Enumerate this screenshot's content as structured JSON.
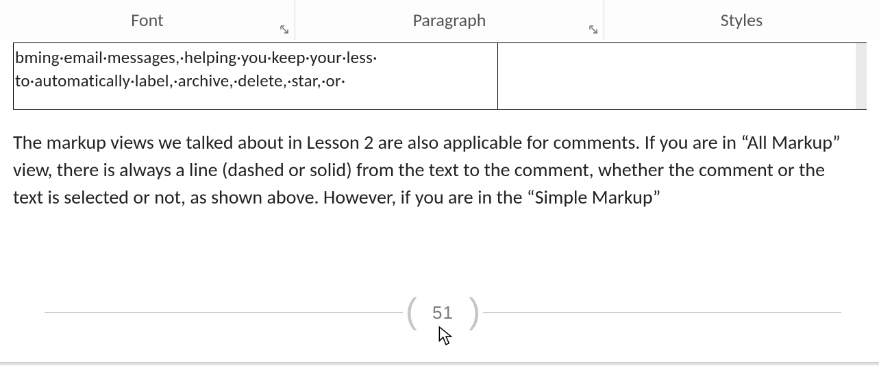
{
  "ribbon": {
    "groups": {
      "font": {
        "label": "Font"
      },
      "paragraph": {
        "label": "Paragraph"
      },
      "styles": {
        "label": "Styles"
      }
    }
  },
  "document": {
    "table_snippet": {
      "line1": "bming·email·messages,·helping·you·keep·your·less·",
      "line2": "to·automatically·label,·archive,·delete,·star,·or·"
    },
    "paragraph": "The markup views we talked about in Lesson 2 are also applicable for comments. If you are in “All Markup” view, there is always a line (dashed or solid) from the text to the comment, whether the comment or the text is selected or not, as shown above. However, if you are in the “Simple Markup”",
    "page_number": "51"
  }
}
